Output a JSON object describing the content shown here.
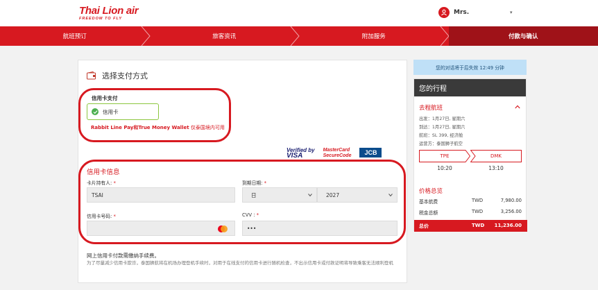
{
  "header": {
    "logo_main": "Thai Lion air",
    "logo_sub": "FREEDOM TO FLY",
    "user_name": "Mrs."
  },
  "steps": [
    {
      "label": "航班预订",
      "active": false
    },
    {
      "label": "旅客资讯",
      "active": false
    },
    {
      "label": "附加服务",
      "active": false
    },
    {
      "label": "付款与确认",
      "active": true
    }
  ],
  "payment": {
    "title": "选择支付方式",
    "cc_section_label": "信用卡支付",
    "cc_option": "信用卡",
    "rabbit_note_bold": "Rabbit Line Pay和True Money Wallet",
    "rabbit_note_light": " 仅泰国境内可用",
    "brands": {
      "visa_top": "Verified by",
      "visa_bottom": "VISA",
      "mc_top": "MasterCard",
      "mc_bottom": "SecureCode",
      "jcb": "JCB"
    }
  },
  "card_info": {
    "section_title": "信用卡信息",
    "holder_label": "卡片持有人:",
    "holder_value": "TSAI",
    "expiry_label": "到期日期:",
    "expiry_month": "日",
    "expiry_year": "2027",
    "number_label": "信用卡号码:",
    "number_value": "",
    "cvv_label": "CVV :",
    "cvv_value": "•••",
    "required_mark": "*"
  },
  "fee": {
    "note": "网上信用卡付款需缴纳手续费。",
    "detail": "为了尽量减少信用卡欺诈，泰国狮航将在机场办理登机手续时，对用于在线支付的信用卡进行随机检查，不出示信用卡或付款证明将导致乘客无法顺利登机"
  },
  "sidebar": {
    "timer": "您的对话将于后失效 12:49 分钟",
    "title": "您的行程",
    "outbound_title": "去程航班",
    "lines": [
      "出发：1月27日, 星期六",
      "到达：1月27日, 星期六",
      "航班：SL 399, 经济舱",
      "运营方：泰国狮子航空"
    ],
    "from_code": "TPE",
    "to_code": "DMK",
    "depart_time": "10:20",
    "arrive_time": "13:10",
    "price_title": "价格总览",
    "prices": [
      {
        "label": "基本航费",
        "currency": "TWD",
        "amount": "7,980.00"
      },
      {
        "label": "税金总额",
        "currency": "TWD",
        "amount": "3,256.00"
      }
    ],
    "total": {
      "label": "总价",
      "currency": "TWD",
      "amount": "11,236.00"
    }
  },
  "colors": {
    "brand_red": "#d71920",
    "active_step": "#9f1218",
    "timer_bg": "#bfe0f7",
    "sidebar_head": "#3a3a3a"
  }
}
